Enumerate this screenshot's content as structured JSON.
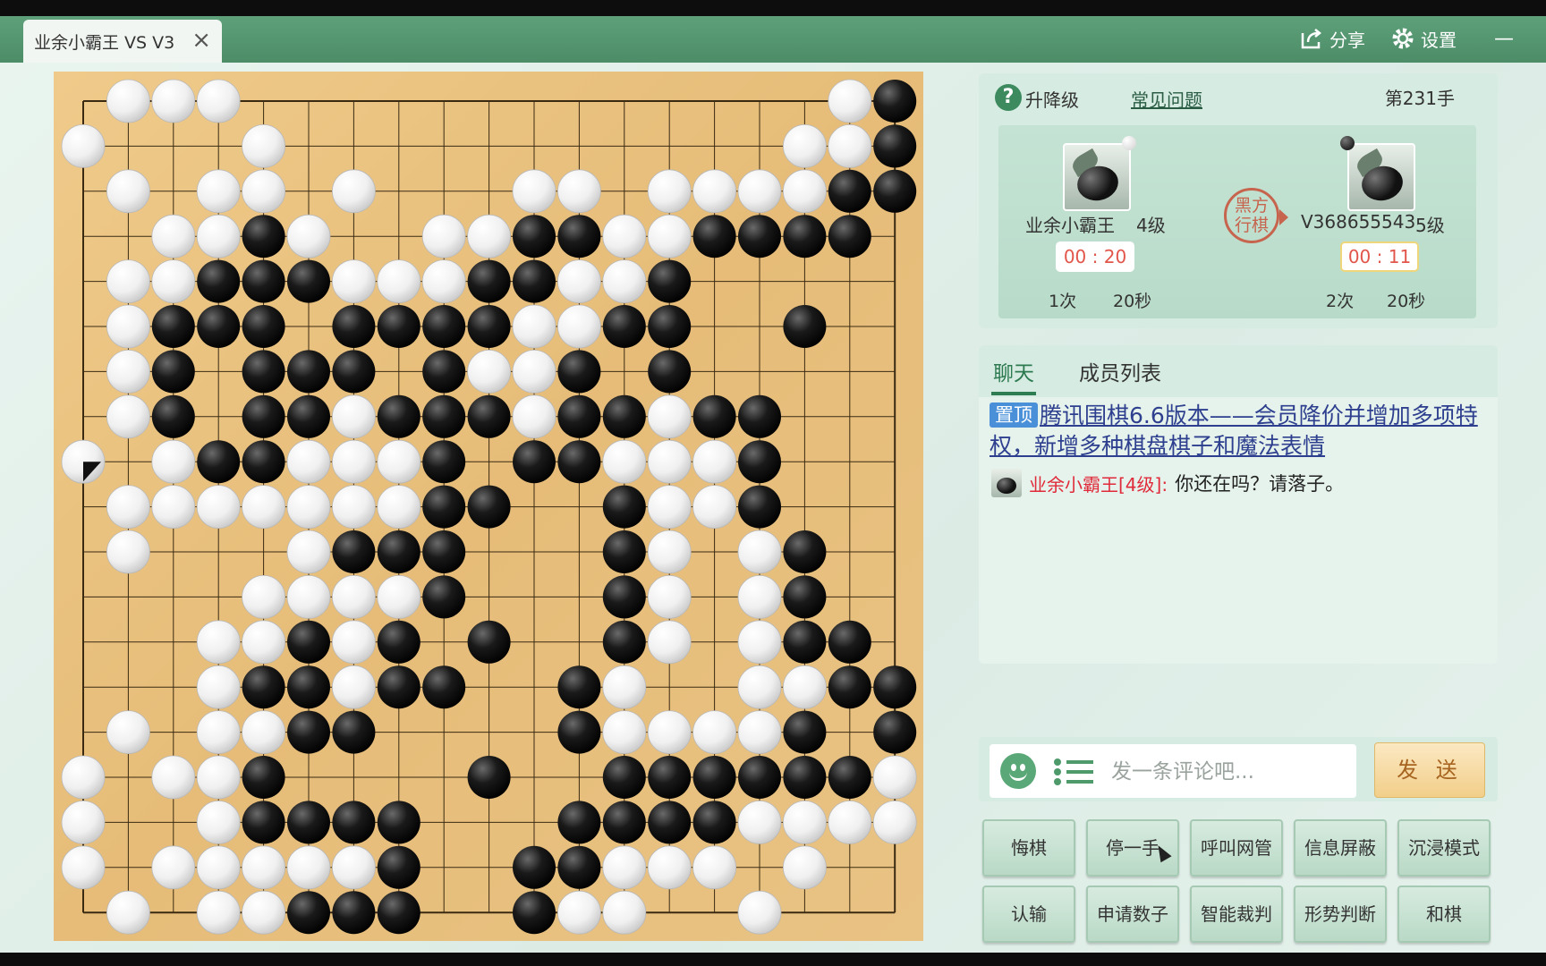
{
  "window": {
    "tab_title": "业余小霸王 VS V3",
    "close_icon": "×",
    "share_label": "分享",
    "settings_label": "设置",
    "minimize_icon": "—"
  },
  "board": {
    "size": 19,
    "last_move": [
      8,
      0
    ],
    "white": [
      [
        0,
        1
      ],
      [
        0,
        2
      ],
      [
        0,
        3
      ],
      [
        0,
        17
      ],
      [
        1,
        0
      ],
      [
        1,
        4
      ],
      [
        1,
        16
      ],
      [
        1,
        17
      ],
      [
        2,
        1
      ],
      [
        2,
        3
      ],
      [
        2,
        4
      ],
      [
        2,
        6
      ],
      [
        2,
        10
      ],
      [
        2,
        11
      ],
      [
        2,
        13
      ],
      [
        2,
        14
      ],
      [
        2,
        15
      ],
      [
        2,
        16
      ],
      [
        3,
        2
      ],
      [
        3,
        3
      ],
      [
        3,
        5
      ],
      [
        3,
        8
      ],
      [
        3,
        9
      ],
      [
        3,
        12
      ],
      [
        3,
        13
      ],
      [
        4,
        1
      ],
      [
        4,
        2
      ],
      [
        4,
        6
      ],
      [
        4,
        7
      ],
      [
        4,
        8
      ],
      [
        4,
        11
      ],
      [
        4,
        12
      ],
      [
        5,
        1
      ],
      [
        5,
        10
      ],
      [
        5,
        11
      ],
      [
        6,
        1
      ],
      [
        6,
        9
      ],
      [
        6,
        10
      ],
      [
        7,
        1
      ],
      [
        7,
        6
      ],
      [
        7,
        10
      ],
      [
        7,
        13
      ],
      [
        8,
        0
      ],
      [
        8,
        2
      ],
      [
        8,
        5
      ],
      [
        8,
        6
      ],
      [
        8,
        7
      ],
      [
        8,
        12
      ],
      [
        8,
        13
      ],
      [
        8,
        14
      ],
      [
        9,
        1
      ],
      [
        9,
        2
      ],
      [
        9,
        3
      ],
      [
        9,
        4
      ],
      [
        9,
        5
      ],
      [
        9,
        6
      ],
      [
        9,
        7
      ],
      [
        9,
        13
      ],
      [
        9,
        14
      ],
      [
        10,
        1
      ],
      [
        10,
        5
      ],
      [
        10,
        13
      ],
      [
        10,
        15
      ],
      [
        11,
        4
      ],
      [
        11,
        5
      ],
      [
        11,
        6
      ],
      [
        11,
        7
      ],
      [
        11,
        13
      ],
      [
        11,
        15
      ],
      [
        12,
        3
      ],
      [
        12,
        4
      ],
      [
        12,
        6
      ],
      [
        12,
        13
      ],
      [
        12,
        15
      ],
      [
        13,
        3
      ],
      [
        13,
        6
      ],
      [
        13,
        12
      ],
      [
        13,
        15
      ],
      [
        13,
        16
      ],
      [
        14,
        1
      ],
      [
        14,
        3
      ],
      [
        14,
        4
      ],
      [
        14,
        12
      ],
      [
        14,
        13
      ],
      [
        14,
        14
      ],
      [
        14,
        15
      ],
      [
        15,
        0
      ],
      [
        15,
        2
      ],
      [
        15,
        3
      ],
      [
        15,
        18
      ],
      [
        16,
        0
      ],
      [
        16,
        3
      ],
      [
        16,
        15
      ],
      [
        16,
        16
      ],
      [
        16,
        17
      ],
      [
        16,
        18
      ],
      [
        17,
        0
      ],
      [
        17,
        2
      ],
      [
        17,
        3
      ],
      [
        17,
        4
      ],
      [
        17,
        5
      ],
      [
        17,
        6
      ],
      [
        17,
        12
      ],
      [
        17,
        13
      ],
      [
        17,
        14
      ],
      [
        17,
        16
      ],
      [
        18,
        1
      ],
      [
        18,
        3
      ],
      [
        18,
        4
      ],
      [
        18,
        11
      ],
      [
        18,
        12
      ],
      [
        18,
        15
      ]
    ],
    "black": [
      [
        0,
        18
      ],
      [
        1,
        18
      ],
      [
        2,
        17
      ],
      [
        2,
        18
      ],
      [
        3,
        4
      ],
      [
        3,
        10
      ],
      [
        3,
        11
      ],
      [
        3,
        14
      ],
      [
        3,
        15
      ],
      [
        3,
        16
      ],
      [
        3,
        17
      ],
      [
        4,
        3
      ],
      [
        4,
        4
      ],
      [
        4,
        5
      ],
      [
        4,
        9
      ],
      [
        4,
        10
      ],
      [
        4,
        13
      ],
      [
        5,
        2
      ],
      [
        5,
        3
      ],
      [
        5,
        4
      ],
      [
        5,
        6
      ],
      [
        5,
        7
      ],
      [
        5,
        8
      ],
      [
        5,
        9
      ],
      [
        5,
        12
      ],
      [
        5,
        13
      ],
      [
        5,
        16
      ],
      [
        6,
        2
      ],
      [
        6,
        4
      ],
      [
        6,
        5
      ],
      [
        6,
        6
      ],
      [
        6,
        8
      ],
      [
        6,
        11
      ],
      [
        6,
        13
      ],
      [
        7,
        2
      ],
      [
        7,
        4
      ],
      [
        7,
        5
      ],
      [
        7,
        7
      ],
      [
        7,
        8
      ],
      [
        7,
        9
      ],
      [
        7,
        11
      ],
      [
        7,
        12
      ],
      [
        7,
        14
      ],
      [
        7,
        15
      ],
      [
        8,
        3
      ],
      [
        8,
        4
      ],
      [
        8,
        8
      ],
      [
        8,
        10
      ],
      [
        8,
        11
      ],
      [
        8,
        15
      ],
      [
        9,
        8
      ],
      [
        9,
        9
      ],
      [
        9,
        12
      ],
      [
        9,
        15
      ],
      [
        10,
        6
      ],
      [
        10,
        7
      ],
      [
        10,
        8
      ],
      [
        10,
        12
      ],
      [
        10,
        16
      ],
      [
        11,
        8
      ],
      [
        11,
        12
      ],
      [
        11,
        16
      ],
      [
        12,
        5
      ],
      [
        12,
        7
      ],
      [
        12,
        9
      ],
      [
        12,
        12
      ],
      [
        12,
        16
      ],
      [
        12,
        17
      ],
      [
        13,
        4
      ],
      [
        13,
        5
      ],
      [
        13,
        7
      ],
      [
        13,
        8
      ],
      [
        13,
        11
      ],
      [
        13,
        17
      ],
      [
        13,
        18
      ],
      [
        14,
        5
      ],
      [
        14,
        6
      ],
      [
        14,
        11
      ],
      [
        14,
        16
      ],
      [
        14,
        18
      ],
      [
        15,
        4
      ],
      [
        15,
        9
      ],
      [
        15,
        12
      ],
      [
        15,
        13
      ],
      [
        15,
        14
      ],
      [
        15,
        15
      ],
      [
        15,
        16
      ],
      [
        15,
        17
      ],
      [
        16,
        4
      ],
      [
        16,
        5
      ],
      [
        16,
        6
      ],
      [
        16,
        7
      ],
      [
        16,
        11
      ],
      [
        16,
        12
      ],
      [
        16,
        13
      ],
      [
        16,
        14
      ],
      [
        17,
        7
      ],
      [
        17,
        10
      ],
      [
        17,
        11
      ],
      [
        18,
        5
      ],
      [
        18,
        6
      ],
      [
        18,
        7
      ],
      [
        18,
        10
      ]
    ]
  },
  "info": {
    "rank_label": "升降级",
    "faq_label": "常见问题",
    "move_count": "第231手",
    "player1": {
      "name": "业余小霸王",
      "rank": "4级",
      "clock": "00 : 20",
      "byoyomi_count": "1次",
      "byoyomi_time": "20秒",
      "indicator": "white"
    },
    "player2": {
      "name": "V368655543",
      "rank": "5级",
      "clock": "00 : 11",
      "byoyomi_count": "2次",
      "byoyomi_time": "20秒",
      "indicator": "black"
    },
    "turn_seal_line1": "黑方",
    "turn_seal_line2": "行棋"
  },
  "chat": {
    "tab_chat": "聊天",
    "tab_members": "成员列表",
    "pin_badge": "置顶",
    "pin_text": "腾讯围棋6.6版本——会员降价并增加多项特权，新增多种棋盘棋子和魔法表情",
    "sender": "业余小霸王[4级]:",
    "message": "你还在吗？请落子。"
  },
  "input": {
    "placeholder": "发一条评论吧...",
    "send_label": "发 送"
  },
  "actions": {
    "undo": "悔棋",
    "pass": "停一手",
    "call_admin": "呼叫网管",
    "block_info": "信息屏蔽",
    "immersive": "沉浸模式",
    "resign": "认输",
    "request_count": "申请数子",
    "ai_judge": "智能裁判",
    "evaluate": "形势判断",
    "draw": "和棋"
  },
  "colors": {
    "accent": "#4c8d67",
    "board": "#e8c17e",
    "clock_text": "#e2554a",
    "sender": "#e02a3a",
    "link": "#2d3f8e"
  }
}
